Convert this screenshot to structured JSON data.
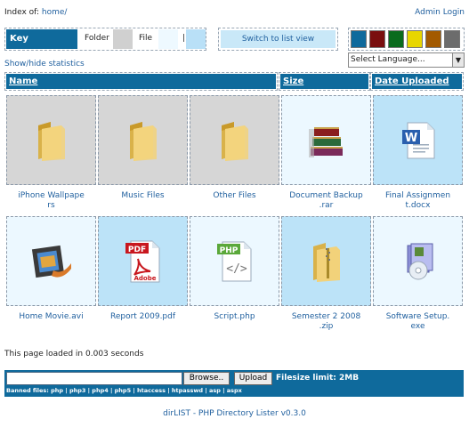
{
  "header": {
    "index_label": "Index of:",
    "path": "home/",
    "admin_login": "Admin Login"
  },
  "key": {
    "label": "Key",
    "folder_label": "Folder",
    "file_label": "File",
    "separator": "|",
    "colors": {
      "folder": "#d0d0d0",
      "file": "#eef9ff",
      "file_alt": "#b9e0f7"
    }
  },
  "switch_view": "Switch to list view",
  "theme_colors": [
    "#0f6a9c",
    "#7a0e0e",
    "#0a6b1d",
    "#e8d600",
    "#a35a00",
    "#6c6c6c"
  ],
  "show_hide_stats": "Show/hide statistics",
  "language": {
    "selected": "Select Language..."
  },
  "columns": {
    "name": "Name",
    "size": "Size",
    "date": "Date Uploaded"
  },
  "items": [
    {
      "caption": [
        "iPhone Wallpape",
        "rs"
      ],
      "icon": "folder-icon"
    },
    {
      "caption": [
        "Music Files"
      ],
      "icon": "folder-icon"
    },
    {
      "caption": [
        "Other Files"
      ],
      "icon": "folder-icon"
    },
    {
      "caption": [
        "Document Backup",
        ".rar"
      ],
      "icon": "rar-archive-icon"
    },
    {
      "caption": [
        "Final Assignmen",
        "t.docx"
      ],
      "icon": "word-document-icon"
    },
    {
      "caption": [
        "Home Movie.avi"
      ],
      "icon": "video-file-icon"
    },
    {
      "caption": [
        "Report 2009.pdf"
      ],
      "icon": "pdf-file-icon",
      "badge": "PDF",
      "brand": "Adobe"
    },
    {
      "caption": [
        "Script.php"
      ],
      "icon": "php-file-icon",
      "badge": "PHP"
    },
    {
      "caption": [
        "Semester 2 2008",
        ".zip"
      ],
      "icon": "zip-folder-icon"
    },
    {
      "caption": [
        "Software Setup.",
        "exe"
      ],
      "icon": "installer-icon"
    }
  ],
  "load_time": "This page loaded in 0.003 seconds",
  "upload": {
    "browse": "Browse..",
    "upload": "Upload",
    "filesize_limit": "Filesize limit: 2MB",
    "banned": "Banned files: php | php3 | php4 | php5 | htaccess | htpasswd | asp | aspx"
  },
  "footer": "dirLIST - PHP Directory Lister v0.3.0"
}
